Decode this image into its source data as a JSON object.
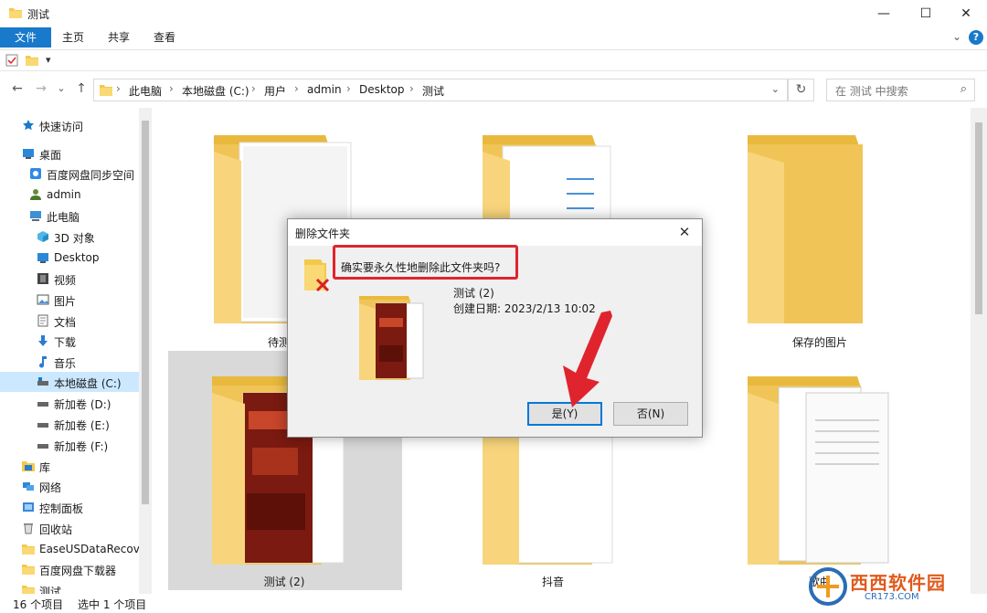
{
  "window": {
    "title": "测试",
    "minimize_symbol": "—",
    "maximize_symbol": "☐",
    "close_symbol": "✕"
  },
  "ribbon": {
    "tabs": [
      "文件",
      "主页",
      "共享",
      "查看"
    ],
    "help_symbol": "?",
    "expand_symbol": "⌄"
  },
  "quick_access_toolbar": {
    "dropdown_symbol": "▾"
  },
  "navigation": {
    "back_symbol": "←",
    "forward_symbol": "→",
    "recent_symbol": "⌄",
    "up_symbol": "↑",
    "breadcrumb": [
      "此电脑",
      "本地磁盘 (C:)",
      "用户",
      "admin",
      "Desktop",
      "测试"
    ],
    "separator": "›",
    "address_dropdown_symbol": "⌄",
    "refresh_symbol": "↻",
    "search_placeholder": "在 测试 中搜索",
    "search_symbol": "⌕"
  },
  "sidebar": {
    "items": [
      {
        "label": "快速访问",
        "icon": "star-icon"
      },
      {
        "label": "桌面",
        "icon": "desktop-icon"
      },
      {
        "label": "百度网盘同步空间",
        "icon": "cloud-sync-icon"
      },
      {
        "label": "admin",
        "icon": "user-icon"
      },
      {
        "label": "此电脑",
        "icon": "computer-icon"
      },
      {
        "label": "3D 对象",
        "icon": "cube-icon"
      },
      {
        "label": "Desktop",
        "icon": "desktop-icon"
      },
      {
        "label": "视频",
        "icon": "video-icon"
      },
      {
        "label": "图片",
        "icon": "picture-icon"
      },
      {
        "label": "文档",
        "icon": "document-icon"
      },
      {
        "label": "下载",
        "icon": "download-icon"
      },
      {
        "label": "音乐",
        "icon": "music-icon"
      },
      {
        "label": "本地磁盘 (C:)",
        "icon": "drive-icon"
      },
      {
        "label": "新加卷 (D:)",
        "icon": "drive-icon"
      },
      {
        "label": "新加卷 (E:)",
        "icon": "drive-icon"
      },
      {
        "label": "新加卷 (F:)",
        "icon": "drive-icon"
      },
      {
        "label": "库",
        "icon": "library-icon"
      },
      {
        "label": "网络",
        "icon": "network-icon"
      },
      {
        "label": "控制面板",
        "icon": "control-panel-icon"
      },
      {
        "label": "回收站",
        "icon": "recycle-bin-icon"
      },
      {
        "label": "EaseUSDataRecov",
        "icon": "folder-icon"
      },
      {
        "label": "百度网盘下载器",
        "icon": "folder-icon"
      },
      {
        "label": "测试",
        "icon": "folder-icon"
      }
    ]
  },
  "folders": [
    {
      "label": "待测试"
    },
    {
      "label": ""
    },
    {
      "label": "保存的图片"
    },
    {
      "label": "测试 (2)"
    },
    {
      "label": "抖音"
    },
    {
      "label": "歌曲"
    }
  ],
  "status_bar": {
    "item_count": "16 个项目",
    "selected": "选中 1 个项目"
  },
  "dialog": {
    "title": "删除文件夹",
    "close_symbol": "✕",
    "question": "确实要永久性地删除此文件夹吗?",
    "folder_name": "测试 (2)",
    "created": "创建日期: 2023/2/13 10:02",
    "yes_button": "是(Y)",
    "no_button": "否(N)"
  },
  "watermark": {
    "text": "西西软件园",
    "subtext": "CR173.COM"
  }
}
